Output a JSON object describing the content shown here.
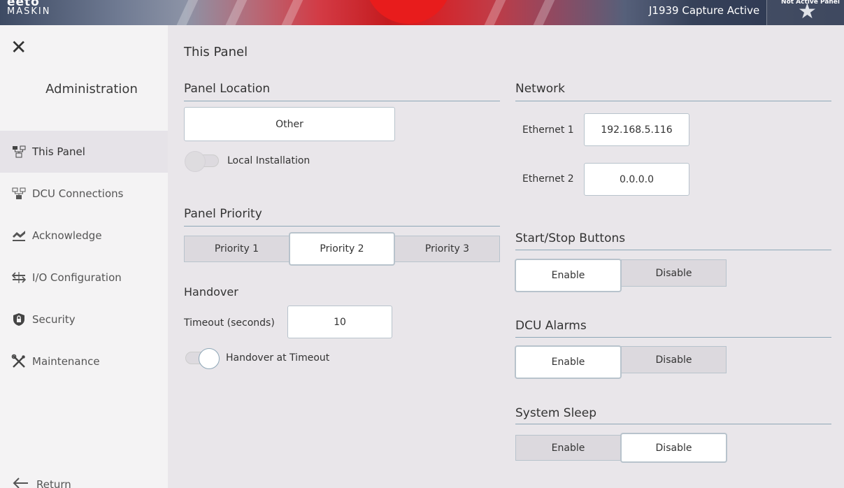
{
  "header": {
    "logo_top": "eeto",
    "logo_bottom": "MASKIN",
    "capture_status": "J1939 Capture Active",
    "active_panel_label": "Not Active Panel"
  },
  "sidebar": {
    "close_icon": "close-icon",
    "title": "Administration",
    "items": [
      {
        "label": "This Panel",
        "icon": "panel-icon",
        "selected": true
      },
      {
        "label": "DCU Connections",
        "icon": "network-icon",
        "selected": false
      },
      {
        "label": "Acknowledge",
        "icon": "acknowledge-icon",
        "selected": false
      },
      {
        "label": "I/O Configuration",
        "icon": "io-icon",
        "selected": false
      },
      {
        "label": "Security",
        "icon": "shield-icon",
        "selected": false
      },
      {
        "label": "Maintenance",
        "icon": "tools-icon",
        "selected": false
      }
    ],
    "return_label": "Return"
  },
  "main": {
    "page_title": "This Panel",
    "panel_location": {
      "title": "Panel Location",
      "value": "Other",
      "local_installation_label": "Local Installation",
      "local_installation_on": false
    },
    "panel_priority": {
      "title": "Panel Priority",
      "options": [
        "Priority 1",
        "Priority 2",
        "Priority 3"
      ],
      "selected": "Priority 2"
    },
    "handover": {
      "title": "Handover",
      "timeout_label": "Timeout (seconds)",
      "timeout_value": "10",
      "handover_at_timeout_label": "Handover at Timeout",
      "handover_at_timeout_on": true
    },
    "network": {
      "title": "Network",
      "eth1_label": "Ethernet 1",
      "eth1_value": "192.168.5.116",
      "eth2_label": "Ethernet 2",
      "eth2_value": "0.0.0.0"
    },
    "start_stop": {
      "title": "Start/Stop Buttons",
      "enable_label": "Enable",
      "disable_label": "Disable",
      "selected": "Enable"
    },
    "dcu_alarms": {
      "title": "DCU Alarms",
      "enable_label": "Enable",
      "disable_label": "Disable",
      "selected": "Enable"
    },
    "system_sleep": {
      "title": "System Sleep",
      "enable_label": "Enable",
      "disable_label": "Disable",
      "selected": "Disable"
    }
  },
  "colors": {
    "accent_line": "#8ea7b7",
    "background": "#e9e6ea",
    "sidebar": "#f4f3f4",
    "selected_nav": "#e6e3e8",
    "brand_red": "#e81c1c"
  }
}
